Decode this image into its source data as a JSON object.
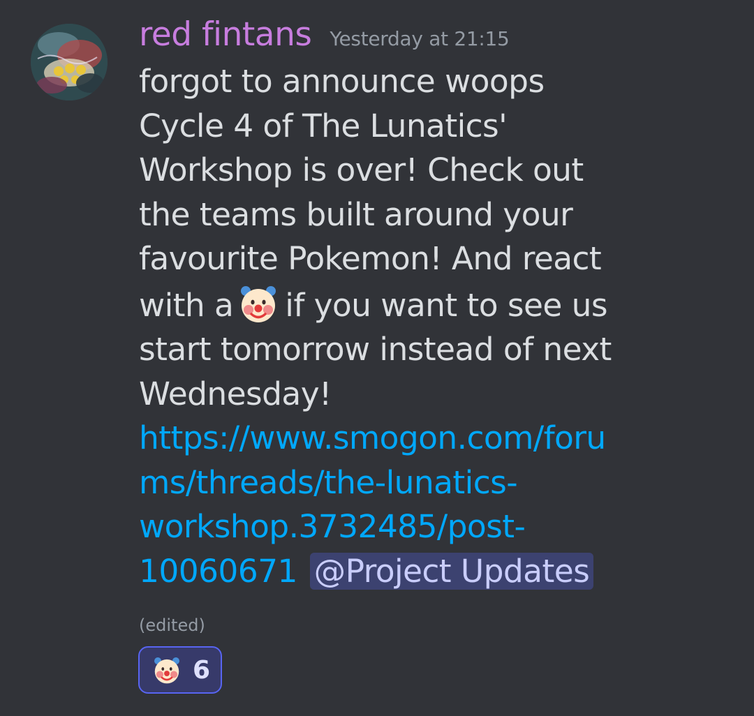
{
  "message": {
    "username": "red fintans",
    "timestamp": "Yesterday at 21:15",
    "text_lines_before_emoji": [
      "forgot to announce woops",
      "Cycle 4 of The Lunatics'",
      "Workshop is over! Check out",
      "the teams built around your",
      "favourite Pokemon! And react"
    ],
    "emoji_line_prefix": "with a",
    "inline_emoji": "clown-face-icon",
    "emoji_line_suffix": "if you want to see us",
    "text_lines_after_emoji": [
      "start tomorrow instead of next",
      "Wednesday!"
    ],
    "link_lines": [
      "https://www.smogon.com/foru",
      "ms/threads/the-lunatics-",
      "workshop.3732485/post-",
      "10060671"
    ],
    "mention": "@Project Updates",
    "edited_label": "(edited)"
  },
  "reaction": {
    "emoji": "clown-face-icon",
    "count": "6"
  },
  "colors": {
    "background": "#313338",
    "username": "#c77dde",
    "timestamp": "#949ba4",
    "text": "#dbdee1",
    "link": "#00a8fc",
    "mention_bg": "#3c4270",
    "mention_text": "#c9cdfb",
    "reaction_border": "#5865f2",
    "reaction_bg": "#373a6a"
  }
}
